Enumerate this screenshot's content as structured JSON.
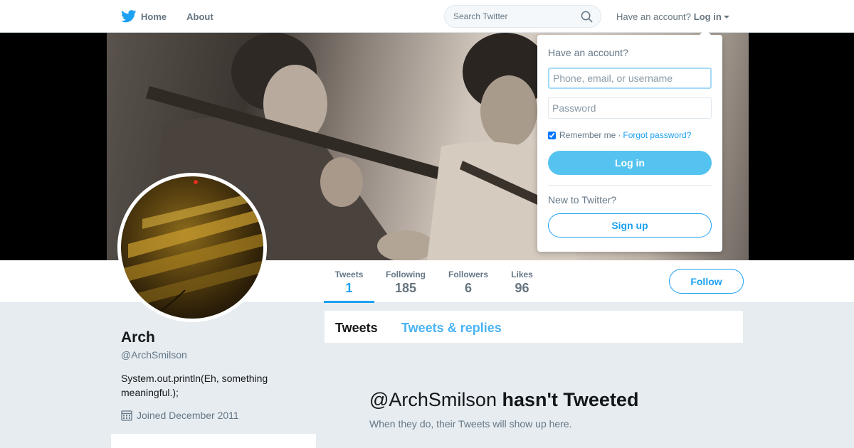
{
  "nav": {
    "home_label": "Home",
    "about_label": "About",
    "search_placeholder": "Search Twitter",
    "have_account_text": "Have an account?",
    "login_label": "Log in"
  },
  "profile": {
    "name": "Arch",
    "handle": "@ArchSmilson",
    "bio": "System.out.println(Eh, something meaningful.);",
    "joined": "Joined December 2011"
  },
  "stats": [
    {
      "label": "Tweets",
      "value": "1"
    },
    {
      "label": "Following",
      "value": "185"
    },
    {
      "label": "Followers",
      "value": "6"
    },
    {
      "label": "Likes",
      "value": "96"
    }
  ],
  "follow_label": "Follow",
  "timeline": {
    "tabs": [
      "Tweets",
      "Tweets & replies"
    ],
    "empty_handle": "@ArchSmilson",
    "empty_title_rest": "hasn't Tweeted",
    "empty_sub": "When they do, their Tweets will show up here."
  },
  "login_dropdown": {
    "title": "Have an account?",
    "username_placeholder": "Phone, email, or username",
    "password_placeholder": "Password",
    "remember_label": "Remember me",
    "separator": "·",
    "forgot_label": "Forgot password?",
    "login_button": "Log in",
    "new_label": "New to Twitter?",
    "signup_button": "Sign up"
  },
  "colors": {
    "accent": "#1da1f2",
    "login_button": "#55c3f0",
    "background": "#e6ecf0"
  },
  "icons": [
    "twitter-bird-icon",
    "search-icon",
    "caret-down-icon",
    "calendar-icon"
  ]
}
